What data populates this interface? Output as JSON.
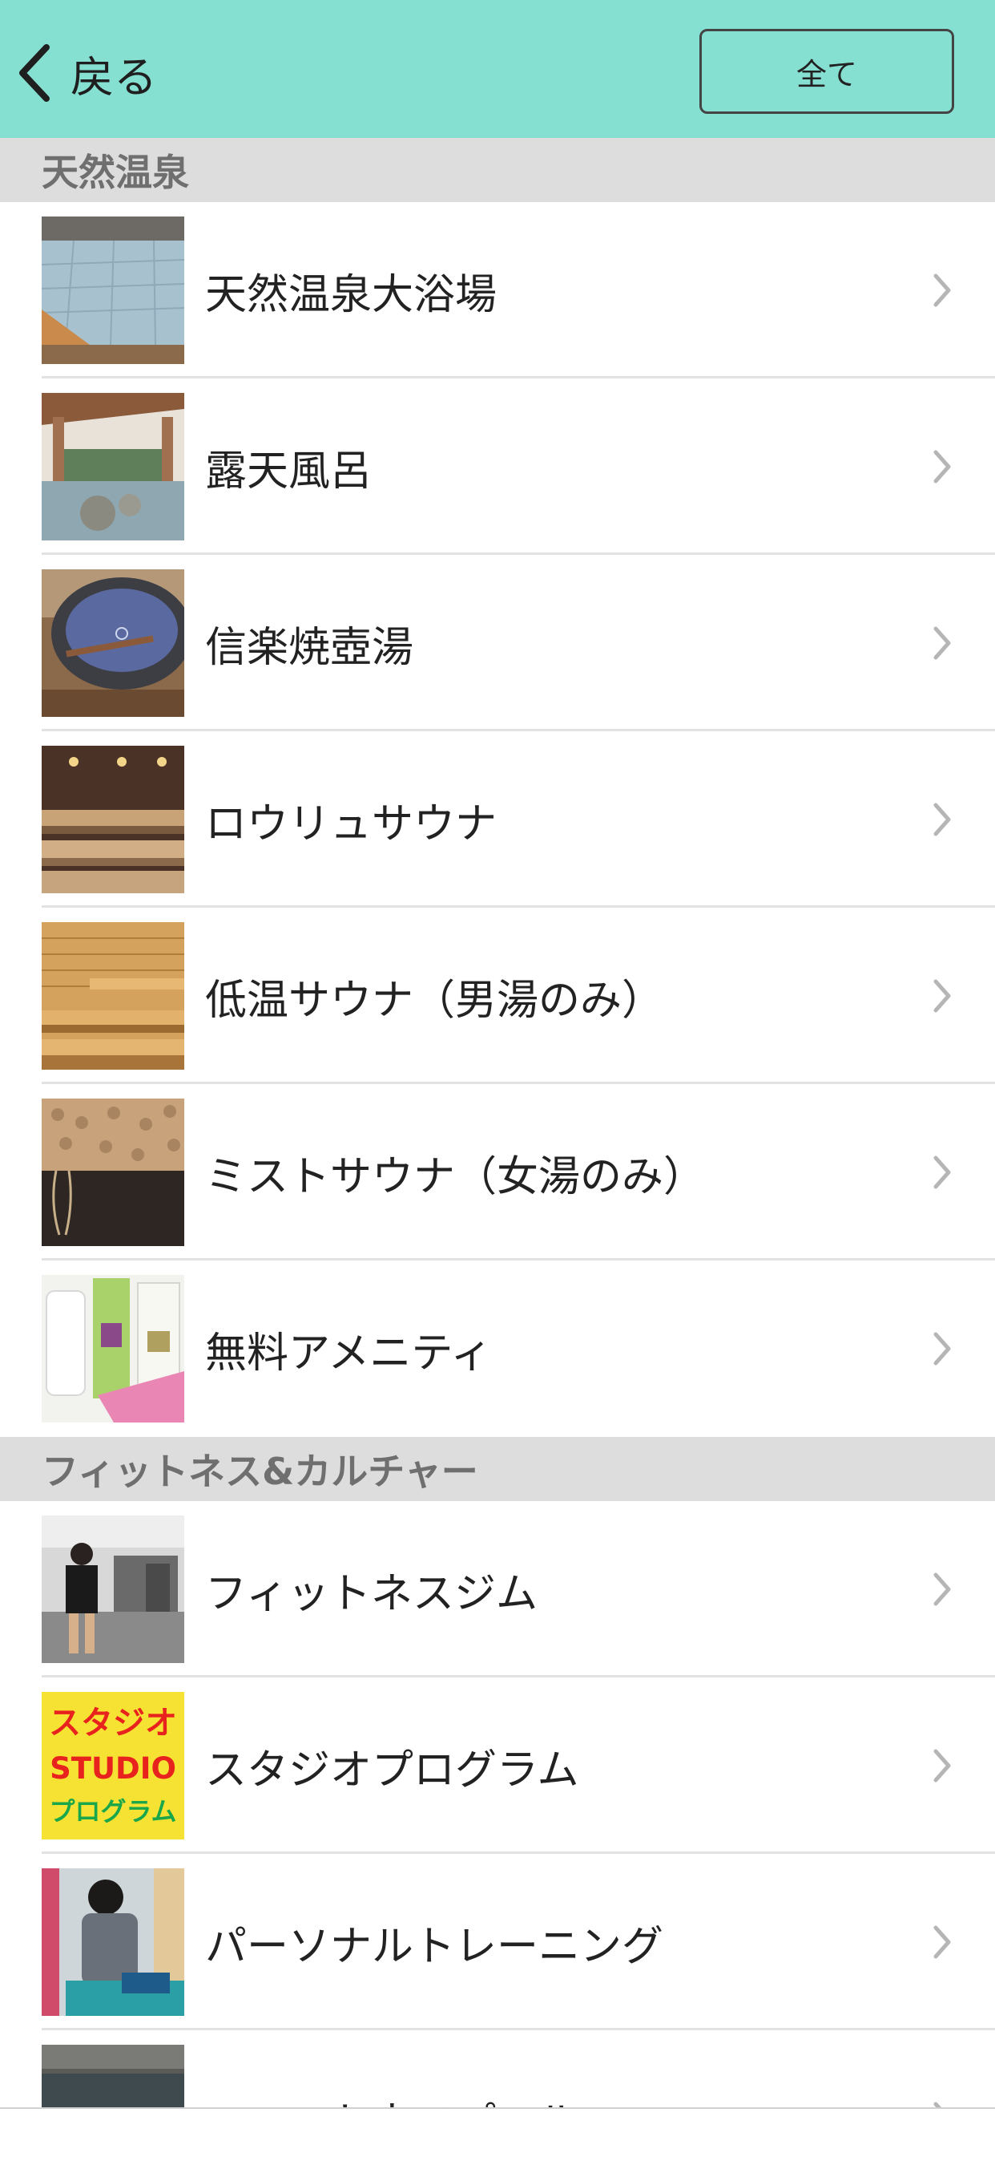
{
  "header": {
    "back_label": "戻る",
    "all_label": "全て",
    "background_color": "#86e0d2"
  },
  "sections": [
    {
      "title": "天然温泉",
      "items": [
        {
          "label": "天然温泉大浴場",
          "thumb": "large-bath-photo"
        },
        {
          "label": "露天風呂",
          "thumb": "outdoor-bath-photo"
        },
        {
          "label": "信楽焼壺湯",
          "thumb": "pot-bath-photo"
        },
        {
          "label": "ロウリュサウナ",
          "thumb": "loyly-sauna-photo"
        },
        {
          "label": "低温サウナ（男湯のみ）",
          "thumb": "low-temp-sauna-photo"
        },
        {
          "label": "ミストサウナ（女湯のみ）",
          "thumb": "mist-sauna-photo"
        },
        {
          "label": "無料アメニティ",
          "thumb": "amenity-photo"
        }
      ]
    },
    {
      "title": "フィットネス&カルチャー",
      "items": [
        {
          "label": "フィットネスジム",
          "thumb": "gym-photo"
        },
        {
          "label": "スタジオプログラム",
          "thumb": "studio-program-logo",
          "thumb_text": [
            "スタジオ",
            "STUDIO",
            "プログラム"
          ]
        },
        {
          "label": "パーソナルトレーニング",
          "thumb": "personal-training-photo"
        },
        {
          "label": "フィットネスプール",
          "thumb": "pool-photo"
        }
      ]
    }
  ]
}
